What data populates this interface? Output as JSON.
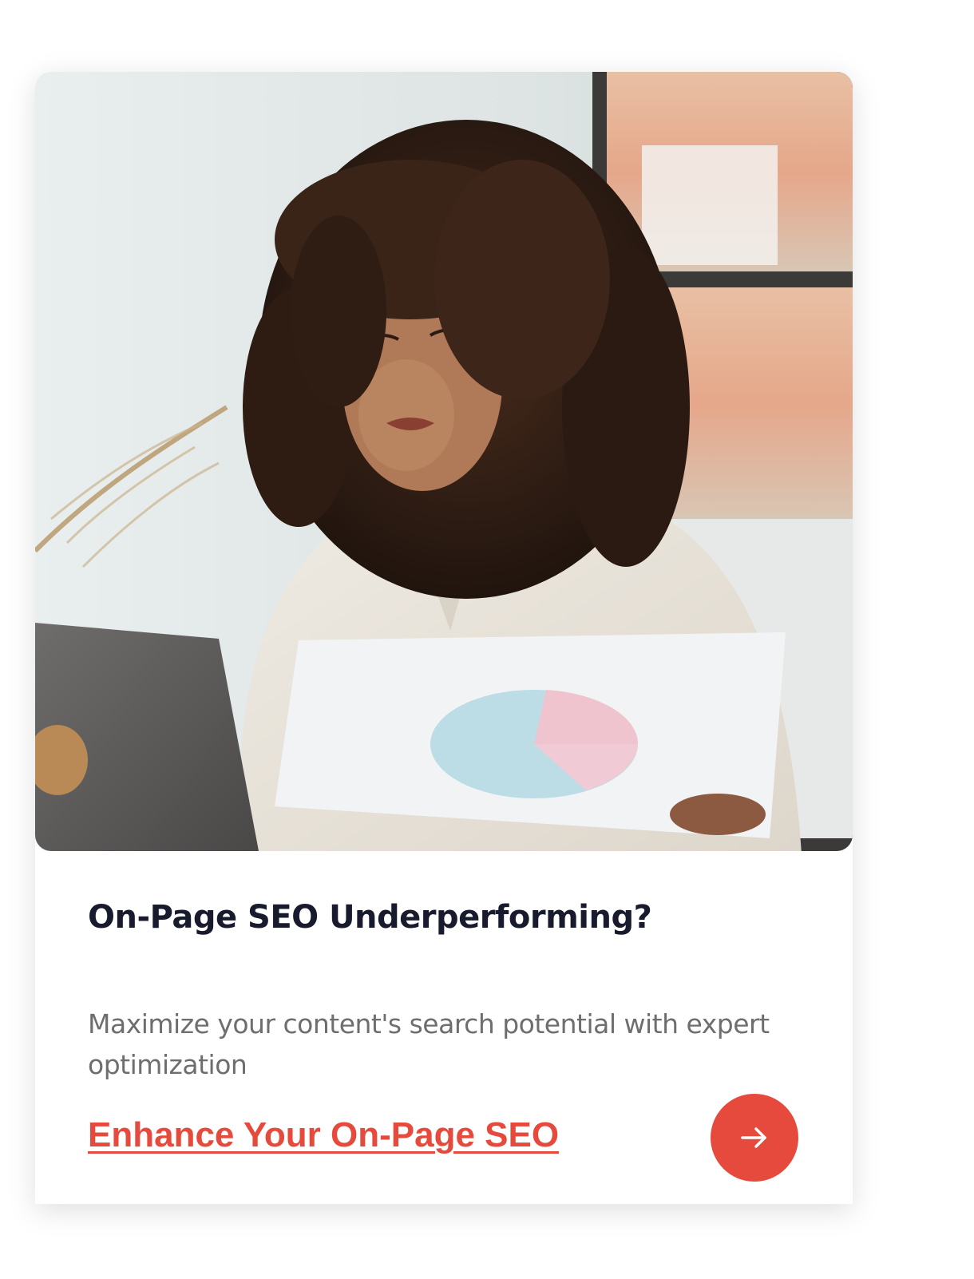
{
  "card": {
    "image_alt_subject": "woman reviewing printed pie chart report beside laptop",
    "title": "On-Page SEO Underperforming?",
    "description": "Maximize your content's search potential with expert optimization",
    "cta_label": "Enhance Your On-Page SEO",
    "arrow_icon": "arrow-right-icon"
  },
  "colors": {
    "accent": "#e54a3c",
    "title": "#181a2e",
    "body_text": "#6e6e6e"
  }
}
